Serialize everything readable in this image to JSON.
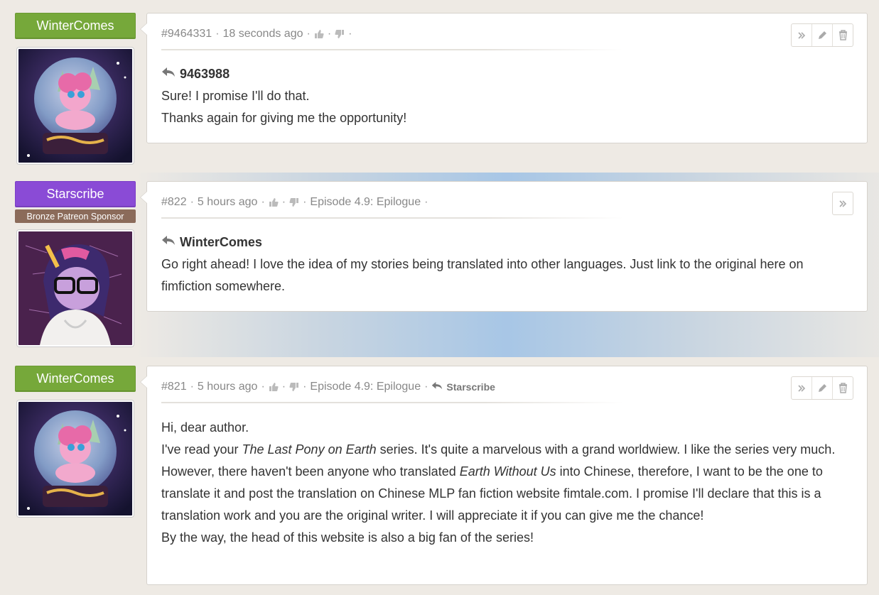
{
  "comments": [
    {
      "author": "WinterComes",
      "badge_color": "#76a83a",
      "meta": {
        "id": "#9464331",
        "time": "18 seconds ago"
      },
      "reply_target": "9463988",
      "body": [
        "Sure! I promise I'll do that.",
        "Thanks again for giving me the opportunity!"
      ],
      "actions": [
        "expand-icon",
        "edit-icon",
        "delete-icon"
      ]
    },
    {
      "author": "Starscribe",
      "badge_color": "#8a4bd6",
      "sponsor": "Bronze Patreon Sponsor",
      "meta": {
        "id": "#822",
        "time": "5 hours ago",
        "chapter": "Episode 4.9: Epilogue"
      },
      "reply_target": "WinterComes",
      "body": [
        "Go right ahead! I love the idea of my stories being translated into other languages. Just link to the original here on fimfiction somewhere."
      ],
      "actions": [
        "expand-icon"
      ]
    },
    {
      "author": "WinterComes",
      "badge_color": "#76a83a",
      "meta": {
        "id": "#821",
        "time": "5 hours ago",
        "chapter": "Episode 4.9: Epilogue",
        "reply_to": "Starscribe"
      },
      "body_parts": {
        "l1": "Hi, dear author.",
        "l2a": "I've read your ",
        "l2b": "The Last Pony on Earth",
        "l2c": " series. It's quite a marvelous with a grand worldwiew. I like the series very much.",
        "l3a": "However, there haven't been anyone who translated ",
        "l3b": "Earth Without Us",
        "l3c": " into Chinese, therefore, I want to be the one to translate it and post the translation on Chinese MLP fan fiction website fimtale.com. I promise I'll declare that this is a translation work and you are the original writer. I will appreciate it if you can give me the chance!",
        "l4": "By the way, the head of this website is also a big fan of the series!"
      },
      "actions": [
        "expand-icon",
        "edit-icon",
        "delete-icon"
      ]
    }
  ],
  "separator": "·"
}
